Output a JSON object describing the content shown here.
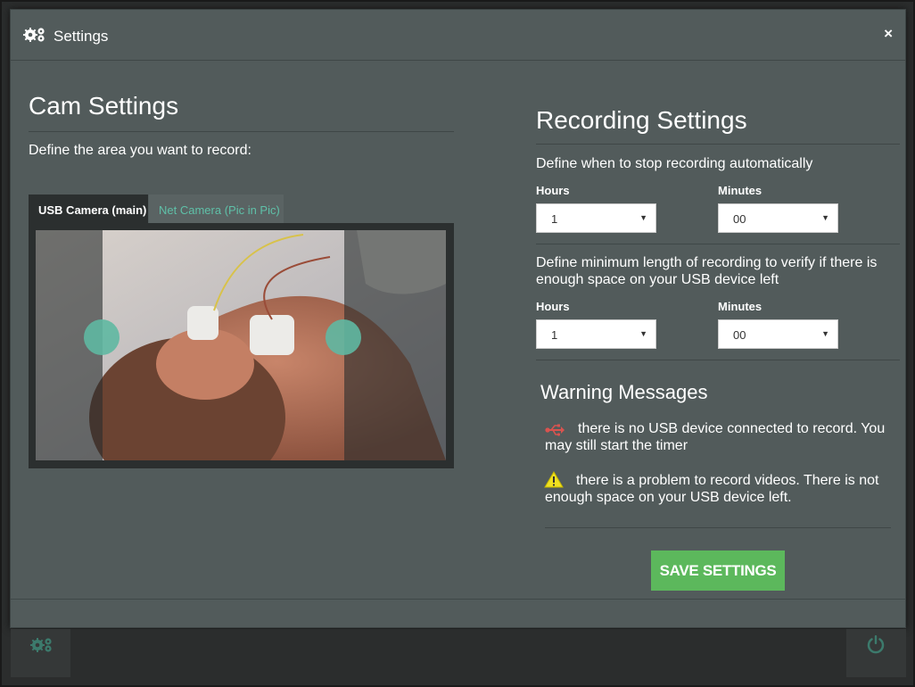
{
  "header": {
    "title": "Settings",
    "icon": "gears-icon",
    "close": "×"
  },
  "cam": {
    "title": "Cam Settings",
    "subtitle": "Define the area you want to record:",
    "tabs": [
      {
        "label": "USB Camera (main)",
        "active": true
      },
      {
        "label": "Net Camera (Pic in Pic)",
        "active": false
      }
    ],
    "accent": "#5fb8a2"
  },
  "recording": {
    "title": "Recording Settings",
    "stop_label": "Define when to stop recording automatically",
    "min_label": "Define minimum length of recording to verify if there is enough space on your USB device left",
    "hours_label": "Hours",
    "minutes_label": "Minutes",
    "stop_hours": "1",
    "stop_minutes": "00",
    "min_hours": "1",
    "min_minutes": "00"
  },
  "warnings": {
    "title": "Warning Messages",
    "usb_msg": "there is no USB device connected to record. You may still start the timer",
    "space_msg": "there is a problem to record videos. There is not enough space on your USB device left.",
    "usb_icon": "usb-icon",
    "warn_icon": "warning-triangle-icon"
  },
  "save_label": "SAVE SETTINGS",
  "colors": {
    "save": "#5cb85c",
    "usb": "#d9534f",
    "warn": "#f0e020"
  }
}
